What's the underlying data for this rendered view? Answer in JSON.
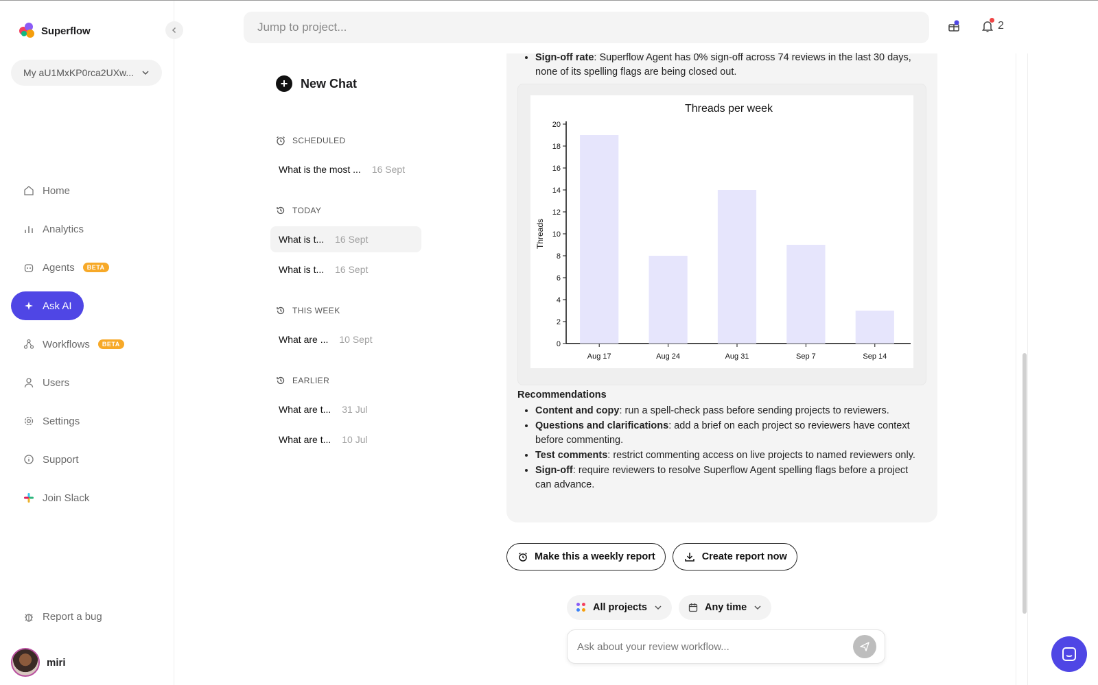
{
  "app": {
    "name": "Superflow",
    "workspace": "My aU1MxKP0rca2UXw..."
  },
  "nav": [
    {
      "label": "Home",
      "icon": "home-icon",
      "active": false,
      "badge": ""
    },
    {
      "label": "Analytics",
      "icon": "bar-chart-icon",
      "active": false,
      "badge": ""
    },
    {
      "label": "Agents",
      "icon": "robot-icon",
      "active": false,
      "badge": "BETA"
    },
    {
      "label": "Ask AI",
      "icon": "sparkle-icon",
      "active": true,
      "badge": ""
    },
    {
      "label": "Workflows",
      "icon": "workflow-icon",
      "active": false,
      "badge": "BETA"
    },
    {
      "label": "Users",
      "icon": "user-icon",
      "active": false,
      "badge": ""
    },
    {
      "label": "Settings",
      "icon": "gear-icon",
      "active": false,
      "badge": ""
    },
    {
      "label": "Support",
      "icon": "info-icon",
      "active": false,
      "badge": ""
    },
    {
      "label": "Join Slack",
      "icon": "slack-icon",
      "active": false,
      "badge": ""
    }
  ],
  "report_bug": "Report a bug",
  "user": {
    "name": "miri"
  },
  "search": {
    "placeholder": "Jump to project..."
  },
  "notifications": {
    "count": "2"
  },
  "chats": {
    "new_chat": "New Chat",
    "sections": [
      {
        "title": "SCHEDULED",
        "icon": "alarm-icon",
        "items": [
          {
            "title": "What is the most ...",
            "date": "16 Sept",
            "selected": false
          }
        ]
      },
      {
        "title": "TODAY",
        "icon": "history-icon",
        "items": [
          {
            "title": "What is t...",
            "date": "16 Sept",
            "selected": true
          },
          {
            "title": "What is t...",
            "date": "16 Sept",
            "selected": false
          }
        ]
      },
      {
        "title": "THIS WEEK",
        "icon": "history-icon",
        "items": [
          {
            "title": "What are ...",
            "date": "10 Sept",
            "selected": false
          }
        ]
      },
      {
        "title": "EARLIER",
        "icon": "history-icon",
        "items": [
          {
            "title": "What are t...",
            "date": "31 Jul",
            "selected": false
          },
          {
            "title": "What are t...",
            "date": "10 Jul",
            "selected": false
          }
        ]
      }
    ]
  },
  "message": {
    "signoff_bold": "Sign-off rate",
    "signoff_text": ": Superflow Agent has 0% sign-off across 74 reviews in the last 30 days, none of its spelling flags are being closed out.",
    "recommendations_title": "Recommendations",
    "recommendations": [
      {
        "bold": "Content and copy",
        "text": ": run a spell-check pass before sending projects to reviewers."
      },
      {
        "bold": "Questions and clarifications",
        "text": ": add a brief on each project so reviewers have context before commenting."
      },
      {
        "bold": "Test comments",
        "text": ": restrict commenting access on live projects to named reviewers only."
      },
      {
        "bold": "Sign-off",
        "text": ": require reviewers to resolve Superflow Agent spelling flags before a project can advance."
      }
    ]
  },
  "actions": {
    "weekly": "Make this a weekly report",
    "create": "Create report now"
  },
  "filters": {
    "projects": "All projects",
    "time": "Any time"
  },
  "ask": {
    "placeholder": "Ask about your review workflow..."
  },
  "colors": {
    "accent": "#4f46e5",
    "bar": "#e6e5fc",
    "beta": "#f7a928"
  },
  "chart_data": {
    "type": "bar",
    "title": "Threads per week",
    "xlabel": "",
    "ylabel": "Threads",
    "categories": [
      "Aug 17",
      "Aug 24",
      "Aug 31",
      "Sep 7",
      "Sep 14"
    ],
    "values": [
      19,
      8,
      14,
      9,
      3
    ],
    "ylim": [
      0,
      20
    ],
    "yticks": [
      0,
      2,
      4,
      6,
      8,
      10,
      12,
      14,
      16,
      18,
      20
    ],
    "grid": false,
    "legend": "none"
  }
}
